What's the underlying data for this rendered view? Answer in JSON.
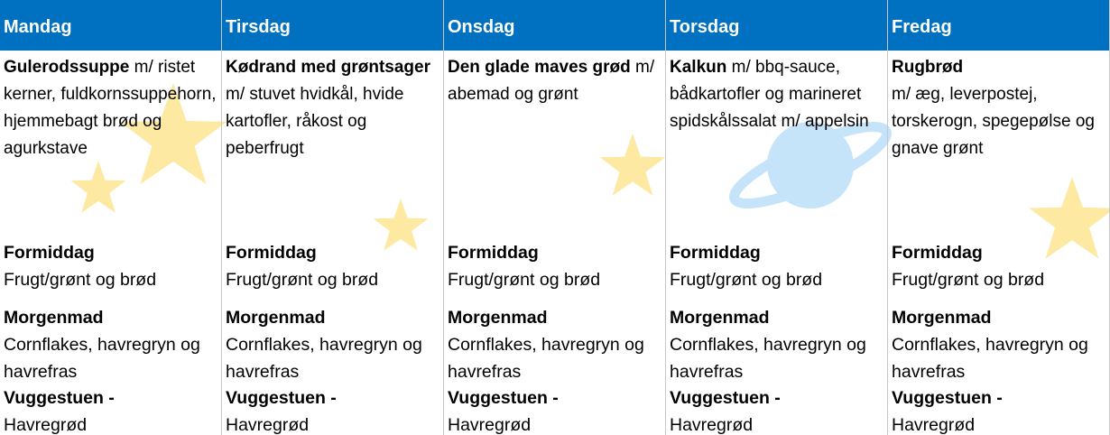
{
  "colors": {
    "header_bg": "#0070c0",
    "header_text": "#ffffff",
    "star": "#fde9a2",
    "planet": "#c5e4fa"
  },
  "days": [
    {
      "name": "Mandag",
      "lunch_bold": "Gulerodssuppe",
      "lunch_rest": " m/ ristet kerner, fuldkornssuppehorn, hjemmebagt brød og agurkstave"
    },
    {
      "name": "Tirsdag",
      "lunch_bold": "Kødrand med grøntsager",
      "lunch_rest": " m/ stuvet hvidkål, hvide kartofler, råkost og peberfrugt"
    },
    {
      "name": "Onsdag",
      "lunch_bold": "Den glade maves grød",
      "lunch_rest": " m/ abemad og grønt"
    },
    {
      "name": "Torsdag",
      "lunch_bold": "Kalkun",
      "lunch_rest": " m/ bbq-sauce, bådkartofler og marineret spidskålssalat m/ appelsin"
    },
    {
      "name": "Fredag",
      "lunch_bold": "Rugbrød",
      "lunch_rest": "m/ æg, leverpostej, torskerogn, spegepølse og gnave grønt"
    }
  ],
  "formiddag": {
    "label": "Formiddag",
    "text": "Frugt/grønt og brød"
  },
  "morgenmad": {
    "label": "Morgenmad",
    "text": "Cornflakes, havregryn og havrefras"
  },
  "vuggestuen": {
    "label": "Vuggestuen -",
    "text": "Havregrød"
  },
  "decorations": [
    "star-icon",
    "planet-icon"
  ]
}
